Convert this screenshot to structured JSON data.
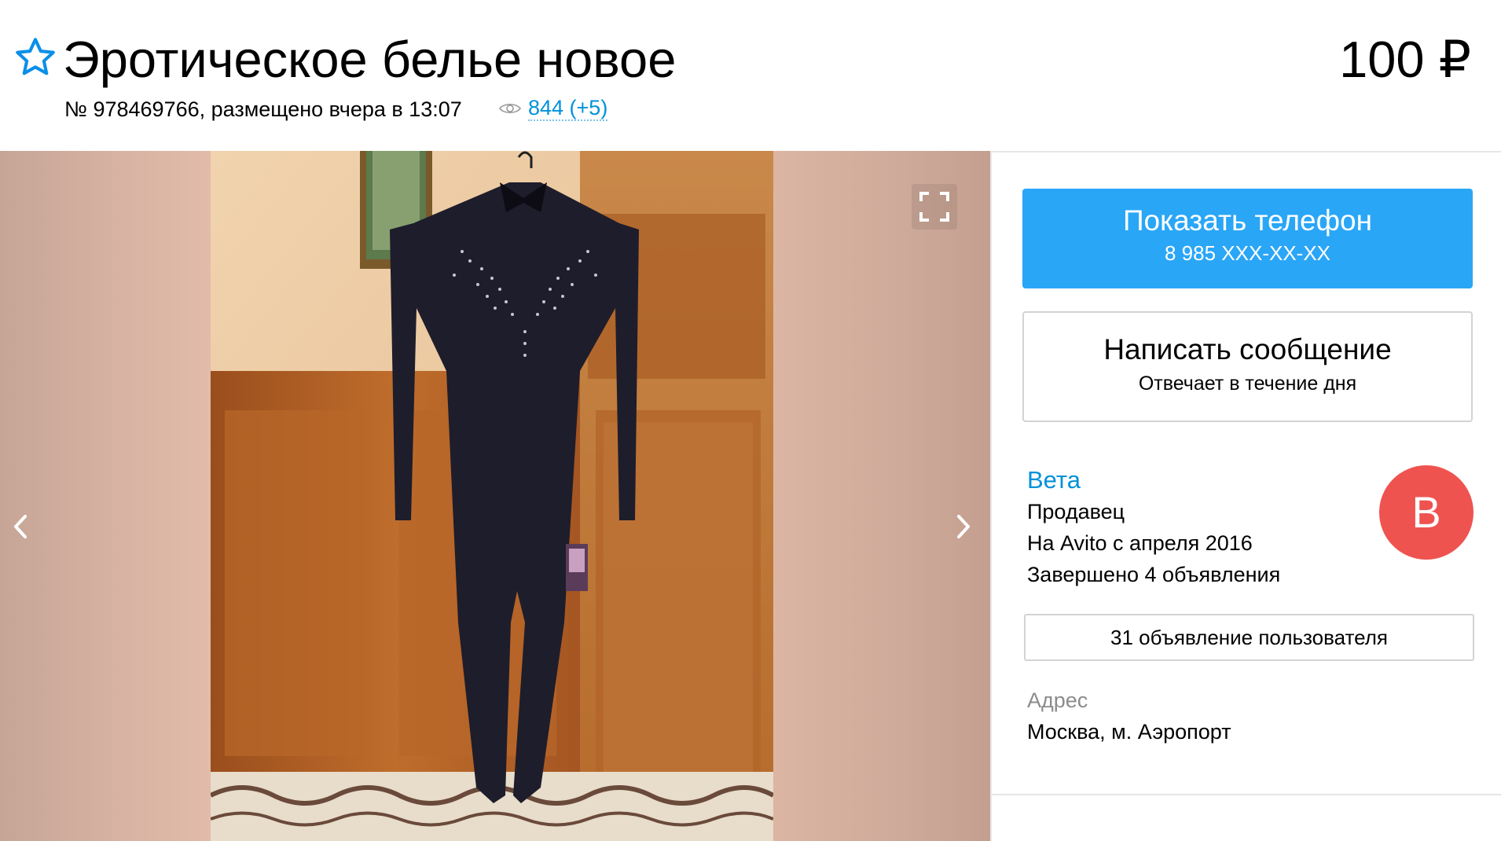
{
  "listing": {
    "title": "Эротическое белье новое",
    "price": "100 ₽",
    "meta": "№ 978469766, размещено вчера в 13:07",
    "views": "844 (+5)"
  },
  "contact": {
    "phone_label": "Показать телефон",
    "phone_number": "8 985 XXX-XX-XX",
    "message_label": "Написать сообщение",
    "message_sub": "Отвечает в течение дня"
  },
  "seller": {
    "name": "Вета",
    "role": "Продавец",
    "since": "На Avito с апреля 2016",
    "completed": "Завершено 4 объявления",
    "avatar_letter": "В",
    "user_ads": "31 объявление пользователя"
  },
  "address": {
    "label": "Адрес",
    "value": "Москва, м. Аэропорт"
  },
  "icons": {
    "favorite": "star-outline-icon",
    "views": "eye-icon",
    "fullscreen": "fullscreen-icon",
    "prev": "chevron-left-icon",
    "next": "chevron-right-icon"
  },
  "colors": {
    "accent": "#0091d9",
    "phone_button": "#2aa6f7",
    "avatar": "#ef5350"
  }
}
